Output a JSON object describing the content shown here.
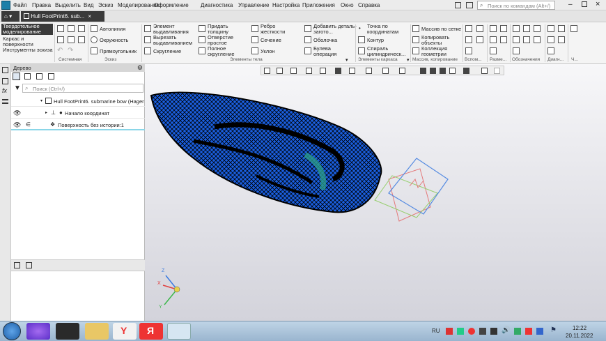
{
  "menu": {
    "items": [
      "Файл",
      "Правка",
      "Выделить",
      "Вид",
      "Эскиз",
      "Моделирование",
      "Оформление",
      "Диагностика",
      "Управление",
      "Настройка",
      "Приложения",
      "Окно",
      "Справка"
    ]
  },
  "search": {
    "placeholder": "Поиск по командам (Alt+/)"
  },
  "tabs": {
    "home": "⌂",
    "doc_title": "Hull FootPrint6. sub..."
  },
  "ribbon": {
    "modes": [
      "Твердотельное моделирование",
      "Каркас и поверхности",
      "Инструменты эскиза"
    ],
    "sketch": [
      "Автолиния",
      "Окружность",
      "Прямоугольник"
    ],
    "body1": [
      "Элемент выдавливания",
      "Вырезать выдавливанием",
      "Скругление"
    ],
    "body2": [
      "Придать толщину",
      "Отверстие простое",
      "Полное скругление"
    ],
    "body3": [
      "Ребро жесткости",
      "Сечение",
      "Уклон"
    ],
    "body4": [
      "Добавить деталь-загото...",
      "Оболочка",
      "Булева операция"
    ],
    "wire": [
      "Точка по координатам",
      "Контур",
      "Спираль цилиндрическ..."
    ],
    "array": [
      "Массив по сетке",
      "Копировать объекты",
      "Коллекция геометрии"
    ],
    "groups": [
      "Системная",
      "Эскиз",
      "Элементы тела",
      "Элементы каркаса",
      "Массив, копирование",
      "Вспом...",
      "Разме...",
      "Обозначения",
      "Диагн...",
      "Ч..."
    ]
  },
  "panel": {
    "title": "Дерево",
    "search_placeholder": "Поиск (Ctrl+/)",
    "tree": [
      "Hull FootPrint6. submarine bow (Hager",
      "Начало координат",
      "Поверхность без истории:1"
    ]
  },
  "viewport": {
    "axes": [
      "Z",
      "X",
      "Y"
    ]
  },
  "taskbar": {
    "lang": "RU",
    "time": "12:22",
    "date": "20.11.2022"
  },
  "colors": {
    "mesh": "#1a5fe0",
    "mesh_dark": "#000000",
    "mesh_accent": "#2a9a8a",
    "tab_active": "#3a3a3a"
  }
}
